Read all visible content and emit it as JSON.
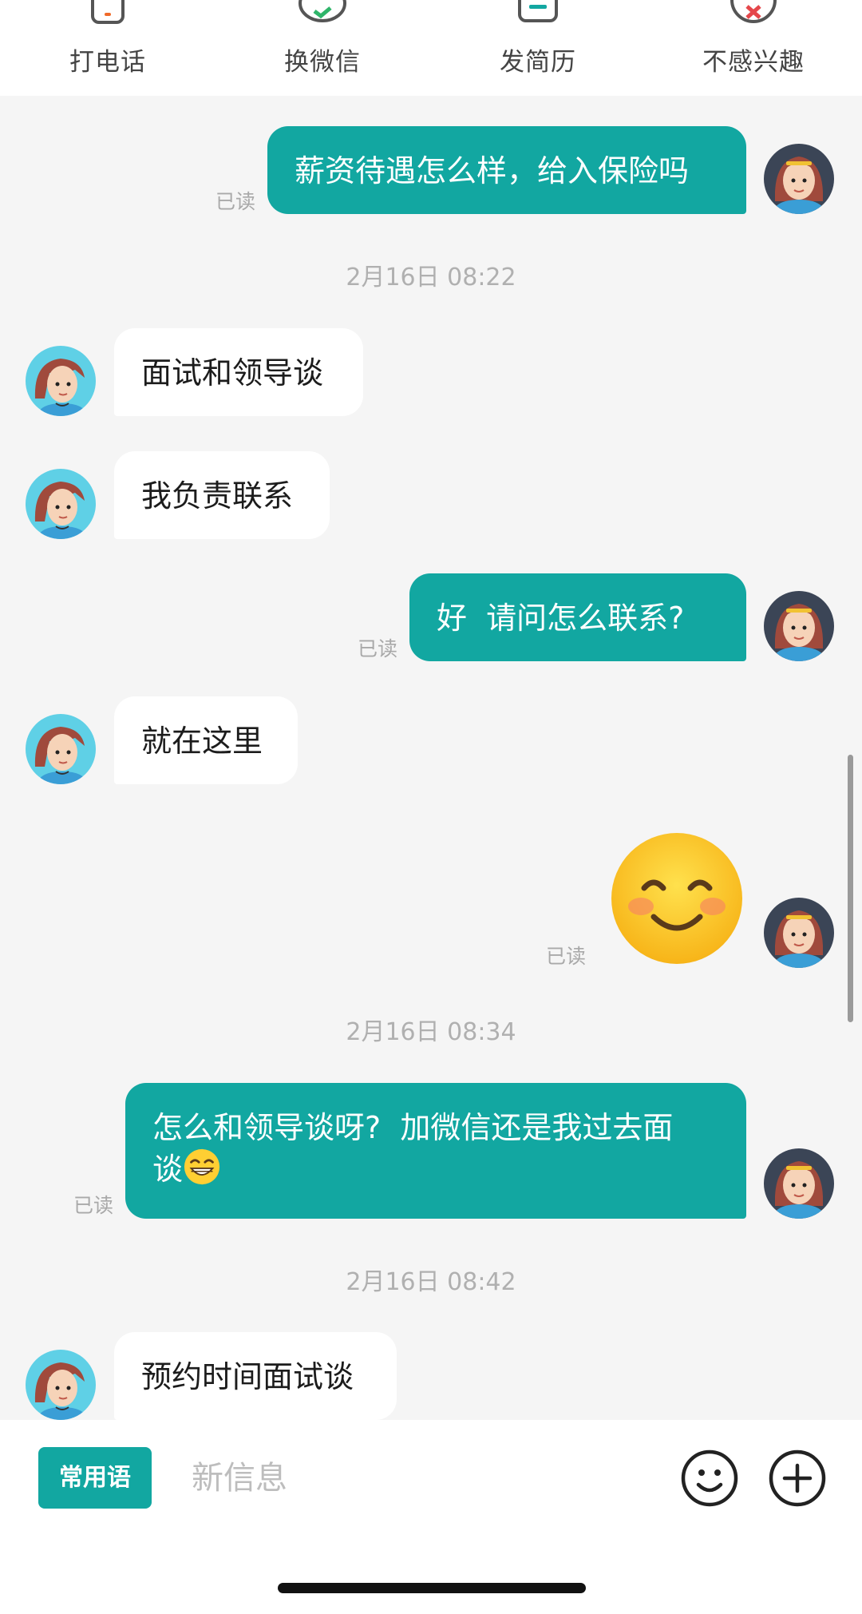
{
  "toolbar": {
    "actions": [
      {
        "label": "打电话",
        "icon": "phone-icon"
      },
      {
        "label": "换微信",
        "icon": "wechat-icon"
      },
      {
        "label": "发简历",
        "icon": "resume-icon"
      },
      {
        "label": "不感兴趣",
        "icon": "not-interested-icon"
      }
    ]
  },
  "colors": {
    "accent": "#12a7a1",
    "background": "#f5f5f5",
    "bubble_other": "#ffffff",
    "timestamp": "#b0b0b0"
  },
  "chat": {
    "read_label": "已读",
    "messages": [
      {
        "from": "me",
        "text": "薪资待遇怎么样，给入保险吗",
        "read": "已读"
      },
      {
        "type": "time",
        "text": "2月16日 08:22"
      },
      {
        "from": "them",
        "text": "面试和领导谈"
      },
      {
        "from": "them",
        "text": "我负责联系"
      },
      {
        "from": "me",
        "text": "好  请问怎么联系?",
        "read": "已读"
      },
      {
        "from": "them",
        "text": "就在这里"
      },
      {
        "from": "me",
        "sticker": "smiling-face-emoji",
        "read": "已读"
      },
      {
        "type": "time",
        "text": "2月16日 08:34"
      },
      {
        "from": "me",
        "text_line1": "怎么和领导谈呀?  加微信还是我过去面",
        "text_line2": "谈",
        "emoji": "grinning-face-emoji",
        "read": "已读"
      },
      {
        "type": "time",
        "text": "2月16日 08:42"
      },
      {
        "from": "them",
        "text": "预约时间面试谈"
      }
    ]
  },
  "input_bar": {
    "phrases_label": "常用语",
    "placeholder": "新信息",
    "emoji_button_icon": "smiley-icon",
    "plus_button_icon": "plus-circle-icon"
  }
}
